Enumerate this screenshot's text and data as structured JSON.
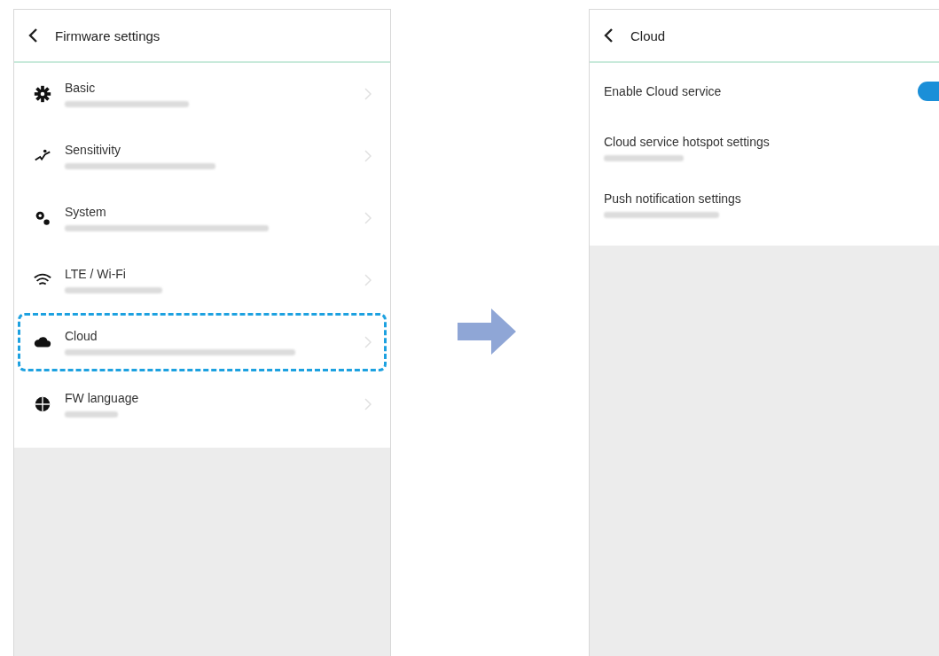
{
  "left_screen": {
    "title": "Firmware settings",
    "items": [
      {
        "label": "Basic",
        "highlighted": false
      },
      {
        "label": "Sensitivity",
        "highlighted": false
      },
      {
        "label": "System",
        "highlighted": false
      },
      {
        "label": "LTE / Wi-Fi",
        "highlighted": false
      },
      {
        "label": "Cloud",
        "highlighted": true
      },
      {
        "label": "FW language",
        "highlighted": false
      }
    ]
  },
  "right_screen": {
    "title": "Cloud",
    "items": [
      {
        "kind": "toggle",
        "label": "Enable Cloud service",
        "on": true
      },
      {
        "kind": "link",
        "label": "Cloud service hotspot settings"
      },
      {
        "kind": "link",
        "label": "Push notification settings"
      }
    ]
  }
}
